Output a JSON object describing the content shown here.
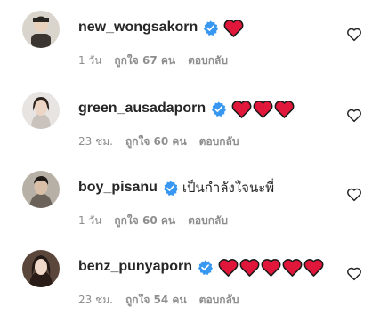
{
  "comments": [
    {
      "username": "new_wongsakorn",
      "verified": true,
      "hearts": 1,
      "text": "",
      "time": "1 วัน",
      "likes": "ถูกใจ 67 คน",
      "reply": "ตอบกลับ",
      "avatar_color": "#3a3530"
    },
    {
      "username": "green_ausadaporn",
      "verified": true,
      "hearts": 3,
      "text": "",
      "time": "23 ชม.",
      "likes": "ถูกใจ 60 คน",
      "reply": "ตอบกลับ",
      "avatar_color": "#c9c2bd"
    },
    {
      "username": "boy_pisanu",
      "verified": true,
      "hearts": 0,
      "text": "เป็นกำลังใจนะพี่",
      "time": "1 วัน",
      "likes": "ถูกใจ 60 คน",
      "reply": "ตอบกลับ",
      "avatar_color": "#a89f96"
    },
    {
      "username": "benz_punyaporn",
      "verified": true,
      "hearts": 5,
      "text": "",
      "time": "23 ชม.",
      "likes": "ถูกใจ 54 คน",
      "reply": "ตอบกลับ",
      "avatar_color": "#3b2a22"
    }
  ],
  "colors": {
    "heart": "#e0163a",
    "verified": "#3897f0",
    "meta": "#8e8e8e",
    "text": "#262626"
  },
  "icons": {
    "verified": "verified-badge-icon",
    "heart": "red-heart-emoji-icon",
    "like": "heart-outline-icon"
  }
}
